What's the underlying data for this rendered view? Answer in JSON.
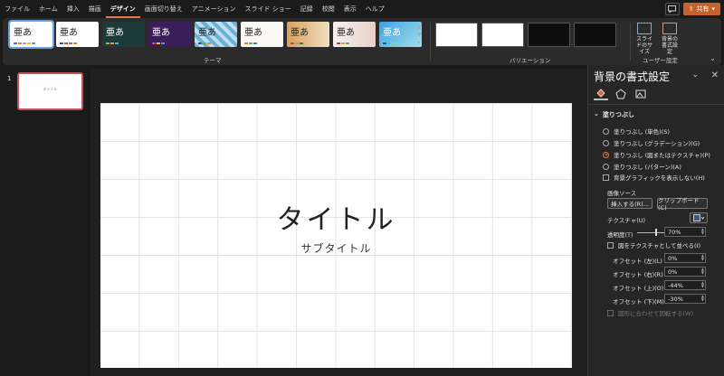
{
  "menu": {
    "tabs": [
      "ファイル",
      "ホーム",
      "挿入",
      "描画",
      "デザイン",
      "画面切り替え",
      "アニメーション",
      "スライド ショー",
      "記録",
      "校閲",
      "表示",
      "ヘルプ"
    ],
    "active": "デザイン",
    "share_label": "共有"
  },
  "ribbon": {
    "theme_sample_text": "亜あ",
    "themes_label": "テーマ",
    "variants_label": "バリエーション",
    "customize_label": "ユーザー設定",
    "slide_size_label": "スライドのサイズ",
    "format_bg_label": "背景の書式設定",
    "accent": "#c8622b"
  },
  "thumbnails": {
    "slide_number": "1",
    "thumb_title": "タイトル"
  },
  "slide": {
    "title": "タイトル",
    "subtitle": "サブタイトル"
  },
  "panel": {
    "title": "背景の書式設定",
    "section": "塗りつぶし",
    "fill_options": [
      "塗りつぶし (単色)(S)",
      "塗りつぶし (グラデーション)(G)",
      "塗りつぶし (図またはテクスチャ)(P)",
      "塗りつぶし (パターン)(A)"
    ],
    "selected_fill": "塗りつぶし (図またはテクスチャ)(P)",
    "hide_bg_graphics": "背景グラフィックを表示しない(H)",
    "image_source": "画像ソース",
    "insert_btn": "挿入する(R)...",
    "clipboard_btn": "クリップボード(C)",
    "texture_label": "テクスチャ(U)",
    "transparency_label": "透明度(T)",
    "transparency_value": "70%",
    "tile_label": "図をテクスチャとして並べる(I)",
    "offsets": [
      {
        "label": "オフセット (左)(L)",
        "value": "0%"
      },
      {
        "label": "オフセット (右)(R)",
        "value": "0%"
      },
      {
        "label": "オフセット (上)(O)",
        "value": "-44%"
      },
      {
        "label": "オフセット (下)(M)",
        "value": "-30%"
      }
    ],
    "rotate_label": "図形に合わせて回転する(W)"
  }
}
